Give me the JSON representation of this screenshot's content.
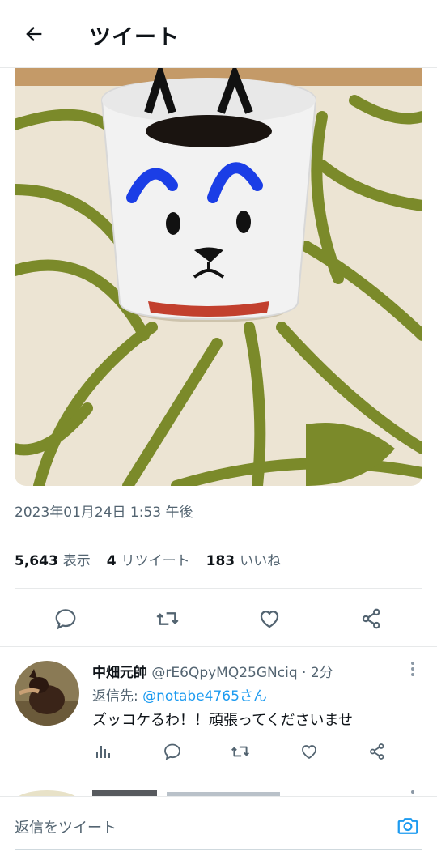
{
  "header": {
    "title": "ツイート",
    "back_icon": "arrow-left-icon"
  },
  "tweet": {
    "photo_alt": "cup-photo",
    "timestamp": "2023年01月24日 1:53 午後",
    "stats": {
      "views_count": "5,643",
      "views_label": "表示",
      "retweets_count": "4",
      "retweets_label": "リツイート",
      "likes_count": "183",
      "likes_label": "いいね"
    },
    "actions": [
      "reply-icon",
      "retweet-icon",
      "like-icon",
      "share-icon"
    ]
  },
  "reply": {
    "name": "中畑元帥",
    "handle": "@rE6QpyMQ25GNciq · 2分",
    "replying_to_label": "返信先: ",
    "replying_to_user": "@notabe4765さん",
    "text": "ズッコケるわ！！頑張ってくださいませ",
    "actions": [
      "analytics-icon",
      "reply-icon",
      "retweet-icon",
      "like-icon",
      "share-icon"
    ]
  },
  "composer": {
    "placeholder": "返信をツイート",
    "camera_icon": "camera-icon"
  },
  "colors": {
    "accent": "#1d9bf0",
    "text": "#0f1419",
    "muted": "#536471",
    "border": "#e7e9ea"
  }
}
